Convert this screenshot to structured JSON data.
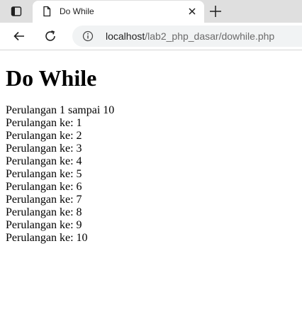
{
  "browser": {
    "tab": {
      "title": "Do While"
    },
    "address": {
      "host": "localhost",
      "path": "/lab2_php_dasar/dowhile.php"
    }
  },
  "page": {
    "heading": "Do While",
    "lines": [
      "Perulangan 1 sampai 10",
      "Perulangan ke: 1",
      "Perulangan ke: 2",
      "Perulangan ke: 3",
      "Perulangan ke: 4",
      "Perulangan ke: 5",
      "Perulangan ke: 6",
      "Perulangan ke: 7",
      "Perulangan ke: 8",
      "Perulangan ke: 9",
      "Perulangan ke: 10"
    ]
  },
  "icons": {
    "tab_actions": "tab-actions-icon",
    "favicon": "page-icon",
    "close": "close-icon",
    "new_tab": "plus-icon",
    "back": "arrow-left-icon",
    "reload": "reload-icon",
    "site_info": "info-icon"
  }
}
